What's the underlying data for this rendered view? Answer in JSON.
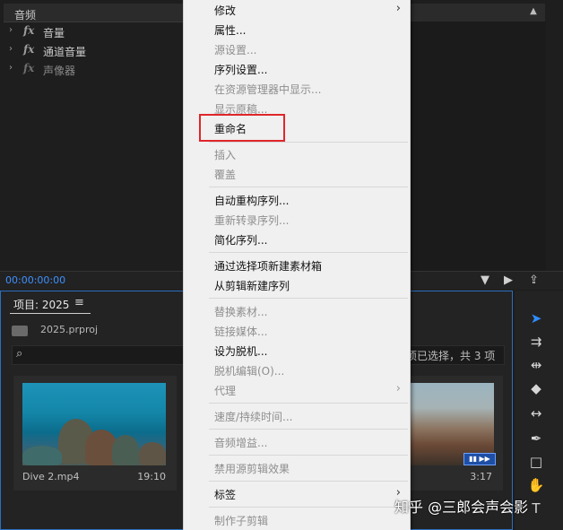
{
  "effects": {
    "title": "音频",
    "rows": [
      {
        "label": "音量",
        "fx": "fx",
        "dim": false
      },
      {
        "label": "通道音量",
        "fx": "fx",
        "dim": false
      },
      {
        "label": "声像器",
        "fx": "fx",
        "dim": true
      }
    ],
    "timecode": "00:00:00:00"
  },
  "project": {
    "title": "项目: 2025",
    "menu_icon": "≡",
    "file": "2025.prproj",
    "selection_info": "项已选择，共 3 项",
    "items": [
      {
        "name": "Dive 2.mp4",
        "duration": "19:10"
      },
      {
        "name": "",
        "duration": "3:17"
      }
    ]
  },
  "menu": {
    "items": [
      {
        "label": "修改",
        "disabled": false,
        "submenu": true
      },
      {
        "label": "属性...",
        "disabled": false,
        "submenu": false
      },
      {
        "label": "源设置...",
        "disabled": true,
        "submenu": false
      },
      {
        "label": "序列设置...",
        "disabled": false,
        "submenu": false
      },
      {
        "label": "在资源管理器中显示...",
        "disabled": true,
        "submenu": false
      },
      {
        "label": "显示原稿...",
        "disabled": true,
        "submenu": false
      },
      {
        "label": "重命名",
        "disabled": false,
        "submenu": false
      },
      {
        "label": "插入",
        "disabled": true,
        "submenu": false
      },
      {
        "label": "覆盖",
        "disabled": true,
        "submenu": false
      },
      {
        "label": "自动重构序列...",
        "disabled": false,
        "submenu": false
      },
      {
        "label": "重新转录序列...",
        "disabled": true,
        "submenu": false
      },
      {
        "label": "简化序列...",
        "disabled": false,
        "submenu": false
      },
      {
        "label": "通过选择项新建素材箱",
        "disabled": false,
        "submenu": false
      },
      {
        "label": "从剪辑新建序列",
        "disabled": false,
        "submenu": false
      },
      {
        "label": "替换素材...",
        "disabled": true,
        "submenu": false
      },
      {
        "label": "链接媒体...",
        "disabled": true,
        "submenu": false
      },
      {
        "label": "设为脱机...",
        "disabled": false,
        "submenu": false
      },
      {
        "label": "脱机编辑(O)...",
        "disabled": true,
        "submenu": false
      },
      {
        "label": "代理",
        "disabled": true,
        "submenu": true
      },
      {
        "label": "速度/持续时间...",
        "disabled": true,
        "submenu": false
      },
      {
        "label": "音频增益...",
        "disabled": true,
        "submenu": false
      },
      {
        "label": "禁用源剪辑效果",
        "disabled": true,
        "submenu": false
      },
      {
        "label": "标签",
        "disabled": false,
        "submenu": true
      },
      {
        "label": "制作子剪辑",
        "disabled": true,
        "submenu": false
      }
    ]
  },
  "watermark": "知乎 @三郎会声会影",
  "colors": {
    "accent": "#2f8dff",
    "highlight": "#e0262b",
    "timecode": "#3f90ff"
  }
}
